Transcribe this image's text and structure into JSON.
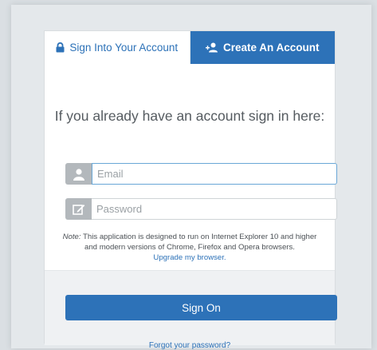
{
  "tabs": {
    "signin_label": "Sign Into Your Account",
    "create_label": "Create An Account"
  },
  "form": {
    "heading": "If you already have an account sign in here:",
    "email_placeholder": "Email",
    "password_placeholder": "Password"
  },
  "note": {
    "prefix": "Note:",
    "text": " This application is designed to run on Internet Explorer 10 and higher and modern versions of Chrome, Firefox and Opera browsers.",
    "upgrade_link": "Upgrade my browser."
  },
  "actions": {
    "signon_label": "Sign On",
    "forgot_label": "Forgot your password?"
  },
  "colors": {
    "accent": "#2d72b8",
    "addon": "#b3b8bc",
    "background": "#dadfe3"
  },
  "icons": {
    "signin_tab": "lock-icon",
    "create_tab": "add-user-icon",
    "email_field": "user-icon",
    "password_field": "edit-icon"
  }
}
